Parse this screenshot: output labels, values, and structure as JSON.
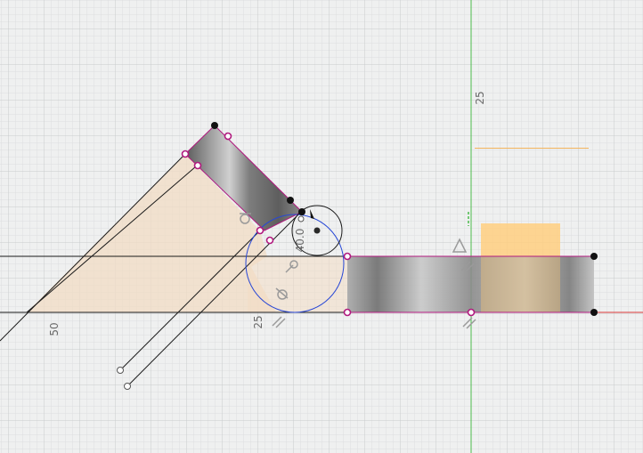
{
  "app": {
    "context": "sketch-canvas"
  },
  "ruler_labels": {
    "x_50": "50",
    "x_25": "25",
    "y_25": "25"
  },
  "dimension": {
    "value": "40.0"
  },
  "colors": {
    "background": "#eff0f0",
    "grid_minor": "#dadcdd",
    "grid_major": "#c9cbcd",
    "y_axis": "#4cbb4c",
    "x_axis": "#d93838",
    "sketch_line": "#1a1a1a",
    "profile_fill": "#f4dcc0",
    "selected_circle": "#2747d6",
    "constraint_point": "#b0197e",
    "highlight_box": "#ffcf80"
  },
  "icons": {
    "constraint_equal": "equal-icon",
    "constraint_parallel": "parallel-icon",
    "constraint_tangent": "tangent-icon",
    "constraint_coincident": "coincident-icon",
    "constraint_triangle": "triangle-icon"
  }
}
